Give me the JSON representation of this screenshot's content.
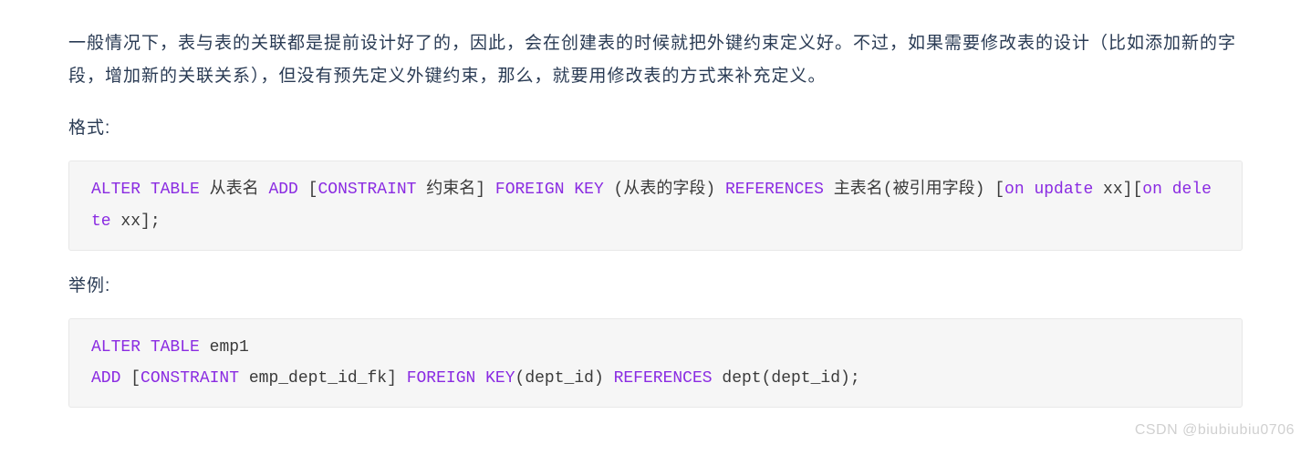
{
  "paragraph1": "一般情况下，表与表的关联都是提前设计好了的，因此，会在创建表的时候就把外键约束定义好。不过，如果需要修改表的设计（比如添加新的字段，增加新的关联关系），但没有预先定义外键约束，那么，就要用修改表的方式来补充定义。",
  "label_format": "格式:",
  "label_example": "举例:",
  "code1": {
    "tokens": [
      {
        "cls": "kw",
        "t": "ALTER"
      },
      {
        "cls": "pl",
        "t": " "
      },
      {
        "cls": "kw",
        "t": "TABLE"
      },
      {
        "cls": "pl",
        "t": " 从表名 "
      },
      {
        "cls": "kw",
        "t": "ADD"
      },
      {
        "cls": "pl",
        "t": " ["
      },
      {
        "cls": "kw",
        "t": "CONSTRAINT"
      },
      {
        "cls": "pl",
        "t": " 约束名] "
      },
      {
        "cls": "kw",
        "t": "FOREIGN"
      },
      {
        "cls": "pl",
        "t": " "
      },
      {
        "cls": "kw",
        "t": "KEY"
      },
      {
        "cls": "pl",
        "t": " (从表的字段) "
      },
      {
        "cls": "kw",
        "t": "REFERENCES"
      },
      {
        "cls": "pl",
        "t": " 主表名(被引用字段) ["
      },
      {
        "cls": "kw",
        "t": "on"
      },
      {
        "cls": "pl",
        "t": " "
      },
      {
        "cls": "kw",
        "t": "update"
      },
      {
        "cls": "pl",
        "t": " xx]["
      },
      {
        "cls": "kw",
        "t": "on"
      },
      {
        "cls": "pl",
        "t": " "
      },
      {
        "cls": "kw",
        "t": "delete"
      },
      {
        "cls": "pl",
        "t": " xx];"
      }
    ]
  },
  "code2": {
    "tokens": [
      {
        "cls": "kw",
        "t": "ALTER"
      },
      {
        "cls": "pl",
        "t": " "
      },
      {
        "cls": "kw",
        "t": "TABLE"
      },
      {
        "cls": "pl",
        "t": " emp1\n"
      },
      {
        "cls": "kw",
        "t": "ADD"
      },
      {
        "cls": "pl",
        "t": " ["
      },
      {
        "cls": "kw",
        "t": "CONSTRAINT"
      },
      {
        "cls": "pl",
        "t": " emp_dept_id_fk] "
      },
      {
        "cls": "kw",
        "t": "FOREIGN"
      },
      {
        "cls": "pl",
        "t": " "
      },
      {
        "cls": "kw",
        "t": "KEY"
      },
      {
        "cls": "pl",
        "t": "(dept_id) "
      },
      {
        "cls": "kw",
        "t": "REFERENCES"
      },
      {
        "cls": "pl",
        "t": " dept(dept_id);"
      }
    ]
  },
  "watermark": "CSDN @biubiubiu0706"
}
